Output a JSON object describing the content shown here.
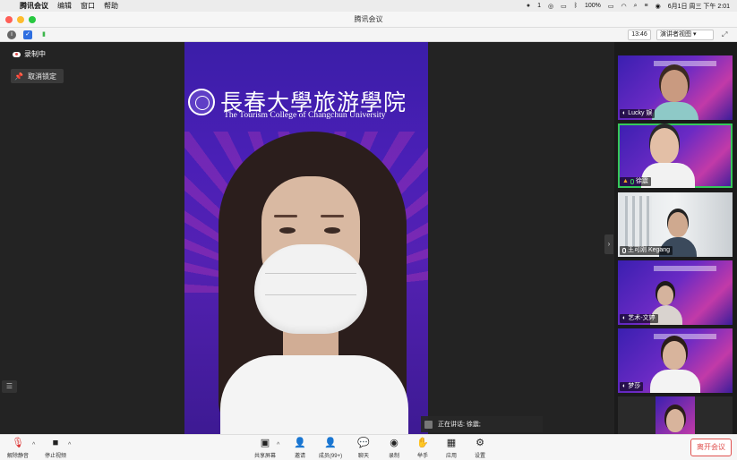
{
  "menubar": {
    "apple": "",
    "app_name": "腾讯会议",
    "menus": [
      "编辑",
      "窗口",
      "帮助"
    ],
    "wechat_badge": "1",
    "battery": "100%",
    "datetime": "6月1日 周三 下午 2:01"
  },
  "window": {
    "title": "腾讯会议",
    "traffic_colors": [
      "#ff5f57",
      "#febc2e",
      "#28c840"
    ]
  },
  "toolbar": {
    "info_glyph": "i",
    "shield_glyph": "✓",
    "signal_glyph": "▮",
    "timer": "13:46",
    "view_label": "演讲者视图 ▾"
  },
  "stage": {
    "recording_label": "录制中",
    "unpin_label": "取消锁定",
    "speaking_label": "正在讲话: 徐震;",
    "logo_cn": "長春大學旅游學院",
    "logo_en": "The Tourism College of Changchun University"
  },
  "participants": [
    {
      "name": "Lucky 娱",
      "icon": "avatar-icon"
    },
    {
      "name": "徐震",
      "icon": "host-icon"
    },
    {
      "name": "王可刚 Kegang",
      "icon": "mic-icon"
    },
    {
      "name": "艺术-文婷",
      "icon": "avatar-icon"
    },
    {
      "name": "梦莎",
      "icon": "avatar-icon"
    },
    {
      "name": "",
      "icon": "avatar-icon"
    }
  ],
  "bottombar": {
    "unmute": "解除静音",
    "stop_video": "停止视频",
    "share": "共享屏幕",
    "invite": "邀请",
    "members": "成员(99+)",
    "chat": "聊天",
    "record": "录制",
    "raise_hand": "举手",
    "apps": "应用",
    "settings": "设置",
    "leave": "离开会议"
  },
  "colors": {
    "accent_red": "#e0504e",
    "speaker_green": "#36c95a"
  }
}
